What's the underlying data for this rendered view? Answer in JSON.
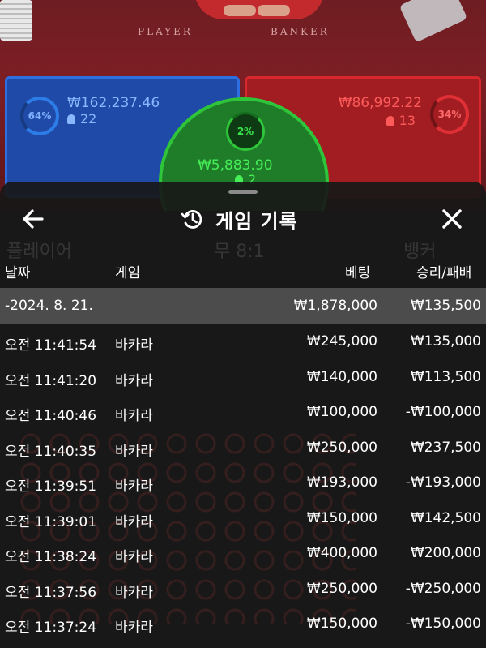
{
  "background": {
    "table_labels": {
      "player": "PLAYER",
      "banker": "BANKER"
    },
    "player": {
      "percent": "64%",
      "amount": "₩162,237.46",
      "count": "22"
    },
    "banker": {
      "percent": "34%",
      "amount": "₩86,992.22",
      "count": "13"
    },
    "tie": {
      "percent": "2%",
      "amount": "₩5,883.90",
      "count": "2"
    },
    "ghost_labels": {
      "player": "플레이어",
      "tie": "무 8:1",
      "banker": "뱅커"
    },
    "colors": {
      "player": "#1f4aa8",
      "banker": "#a11d22",
      "tie": "#1f7d2a"
    }
  },
  "sheet": {
    "title": "게임 기록",
    "icons": {
      "back": "arrow-left-icon",
      "history": "history-icon",
      "close": "close-icon"
    },
    "columns": {
      "date": "날짜",
      "game": "게임",
      "bet": "베팅",
      "result": "승리/패배"
    },
    "date_group": {
      "date": "-2024. 8. 21.",
      "bet_total": "₩1,878,000",
      "result_total": "₩135,500"
    },
    "rows": [
      {
        "time": "오전 11:41:54",
        "game": "바카라",
        "bet": "₩245,000",
        "result": "₩135,000"
      },
      {
        "time": "오전 11:41:20",
        "game": "바카라",
        "bet": "₩140,000",
        "result": "₩113,500"
      },
      {
        "time": "오전 11:40:46",
        "game": "바카라",
        "bet": "₩100,000",
        "result": "-₩100,000"
      },
      {
        "time": "오전 11:40:35",
        "game": "바카라",
        "bet": "₩250,000",
        "result": "₩237,500"
      },
      {
        "time": "오전 11:39:51",
        "game": "바카라",
        "bet": "₩193,000",
        "result": "-₩193,000"
      },
      {
        "time": "오전 11:39:01",
        "game": "바카라",
        "bet": "₩150,000",
        "result": "₩142,500"
      },
      {
        "time": "오전 11:38:24",
        "game": "바카라",
        "bet": "₩400,000",
        "result": "₩200,000"
      },
      {
        "time": "오전 11:37:56",
        "game": "바카라",
        "bet": "₩250,000",
        "result": "-₩250,000"
      },
      {
        "time": "오전 11:37:24",
        "game": "바카라",
        "bet": "₩150,000",
        "result": "-₩150,000"
      }
    ]
  }
}
